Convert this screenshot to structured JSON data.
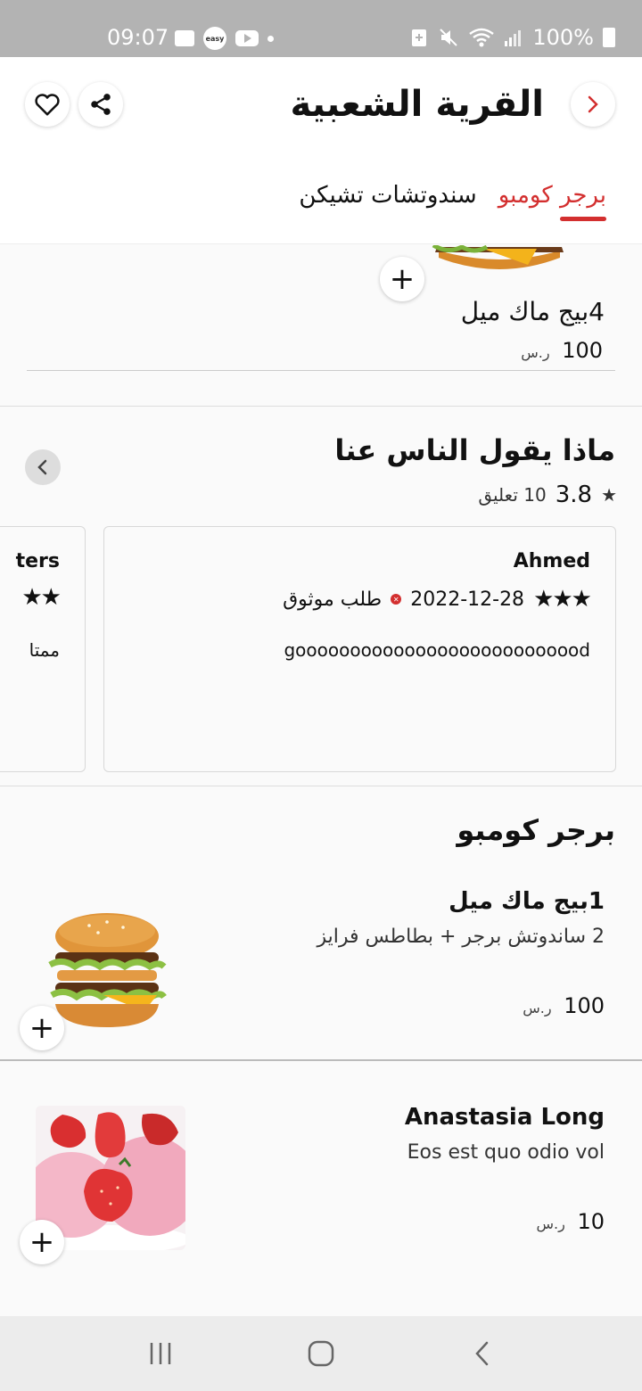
{
  "status_bar": {
    "time": "09:07",
    "easy_icon_text": "easy",
    "battery": "100%"
  },
  "header": {
    "title": "القرية الشعبية",
    "tabs": [
      {
        "label": "برجر كومبو",
        "active": true
      },
      {
        "label": "سندوتشات تشيكن",
        "active": false
      }
    ]
  },
  "top_product": {
    "name": "4بيج ماك ميل",
    "price": "100",
    "currency": "ر.س"
  },
  "reviews": {
    "title": "ماذا يقول الناس عنا",
    "rating": "3.8",
    "count_label": "10 تعليق",
    "cards": [
      {
        "name": "Ahmed",
        "stars": "★★★",
        "date": "2022-12-28",
        "verified_label": "طلب موثوق",
        "text": "gooooooooooooooooooooooooood"
      },
      {
        "name": "ters",
        "stars": "★★",
        "text": "ممتا"
      }
    ]
  },
  "section": {
    "title": "برجر كومبو",
    "products": [
      {
        "name": "1بيج ماك ميل",
        "description": "2 ساندوتش برجر + بطاطس فرايز",
        "price": "100",
        "currency": "ر.س"
      },
      {
        "name": "Anastasia Long",
        "description": "Eos est quo odio vol",
        "price": "10",
        "currency": "ر.س"
      }
    ]
  },
  "colors": {
    "accent": "#d32f2f",
    "status_bar": "#b3b3b3",
    "nav_bar": "#ececec"
  },
  "icons": {
    "add": "+",
    "rating_star": "★"
  }
}
